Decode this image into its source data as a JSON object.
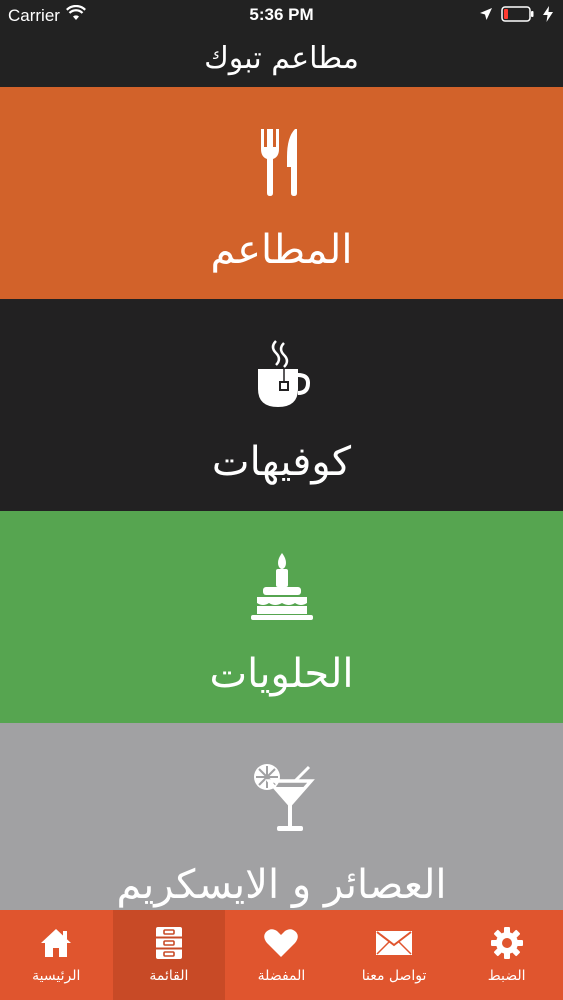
{
  "status_bar": {
    "carrier": "Carrier",
    "time": "5:36 PM",
    "icons": [
      "wifi-icon",
      "location-arrow-icon",
      "battery-icon",
      "charging-bolt-icon"
    ]
  },
  "header": {
    "title": "مطاعم تبوك"
  },
  "categories": [
    {
      "label": "المطاعم",
      "icon": "fork-knife-icon",
      "color": "#d2622a"
    },
    {
      "label": "كوفيهات",
      "icon": "teacup-icon",
      "color": "#222122"
    },
    {
      "label": "الحلويات",
      "icon": "cake-icon",
      "color": "#56a550"
    },
    {
      "label": "العصائر و الايسكريم",
      "icon": "cocktail-icon",
      "color": "#a1a1a3"
    }
  ],
  "tab_bar": {
    "color": "#e0552e",
    "active_color": "#c84a26",
    "tabs": [
      {
        "label": "الرئيسية",
        "icon": "home-icon"
      },
      {
        "label": "القائمة",
        "icon": "cabinet-icon",
        "active": true
      },
      {
        "label": "المفضلة",
        "icon": "heart-icon"
      },
      {
        "label": "تواصل معنا",
        "icon": "envelope-icon"
      },
      {
        "label": "الضبط",
        "icon": "gear-icon"
      }
    ]
  }
}
